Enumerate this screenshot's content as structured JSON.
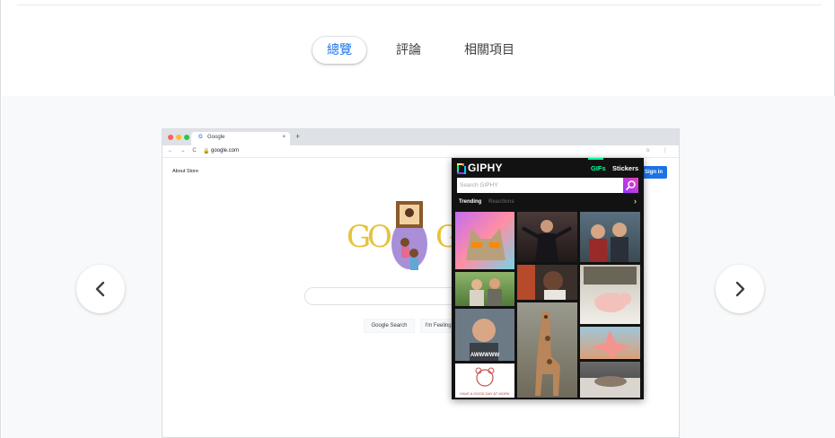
{
  "tabs": [
    {
      "label": "總覽",
      "active": true
    },
    {
      "label": "評論",
      "active": false
    },
    {
      "label": "相關項目",
      "active": false
    }
  ],
  "gallery": {
    "prev_icon": "chevron-left-icon",
    "next_icon": "chevron-right-icon"
  },
  "browser": {
    "tab_title": "Google",
    "tab_close": "×",
    "new_tab": "+",
    "url": "google.com",
    "nav_glyphs": "← → C",
    "toolbar_glyphs": "☆ ⋮",
    "links": "About   Store",
    "signin_label": "Sign in",
    "search_button": "Google Search",
    "lucky_button": "I'm Feeling",
    "doodle_letters": [
      "G",
      "O",
      "G"
    ]
  },
  "giphy": {
    "logo": "GIPHY",
    "tab_gifs": "GIFs",
    "tab_stickers": "Stickers",
    "search_placeholder": "Search GIPHY",
    "categories": [
      "Trending",
      "Reactions"
    ],
    "more": "›",
    "tile_caption": "AWWWWW",
    "tile_caption_small": "HAVE A GOOD DAY AT WORK"
  },
  "colors": {
    "accent": "#1a73e8",
    "giphy_green": "#00ff99",
    "giphy_bg": "#121212"
  }
}
